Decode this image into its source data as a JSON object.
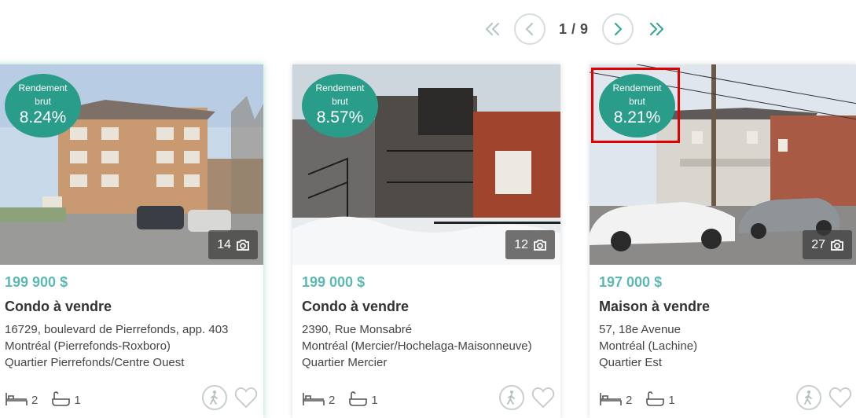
{
  "pagination": {
    "current": "1 / 9",
    "first_icon": "double-chevron-left-icon",
    "prev_icon": "chevron-left-icon",
    "next_icon": "chevron-right-icon",
    "last_icon": "double-chevron-right-icon"
  },
  "colors": {
    "accent": "#2a9d8a",
    "price": "#5cb8b2",
    "highlight": "#e00000"
  },
  "listings": [
    {
      "badge_line1": "Rendement",
      "badge_line2": "brut",
      "yield": "8.24%",
      "photo_count": "14",
      "price": "199 900 $",
      "type": "Condo à vendre",
      "address1": "16729, boulevard de Pierrefonds, app. 403",
      "address2": "Montréal (Pierrefonds-Roxboro)",
      "address3": "Quartier Pierrefonds/Centre Ouest",
      "bedrooms": "2",
      "bathrooms": "1"
    },
    {
      "badge_line1": "Rendement",
      "badge_line2": "brut",
      "yield": "8.57%",
      "photo_count": "12",
      "price": "199 000 $",
      "type": "Condo à vendre",
      "address1": "2390, Rue Monsabré",
      "address2": "Montréal (Mercier/Hochelaga-Maisonneuve)",
      "address3": "Quartier Mercier",
      "bedrooms": "2",
      "bathrooms": "1"
    },
    {
      "badge_line1": "Rendement",
      "badge_line2": "brut",
      "yield": "8.21%",
      "photo_count": "27",
      "price": "197 000 $",
      "type": "Maison à vendre",
      "address1": "57, 18e Avenue",
      "address2": "Montréal (Lachine)",
      "address3": "Quartier Est",
      "bedrooms": "2",
      "bathrooms": "1"
    }
  ]
}
